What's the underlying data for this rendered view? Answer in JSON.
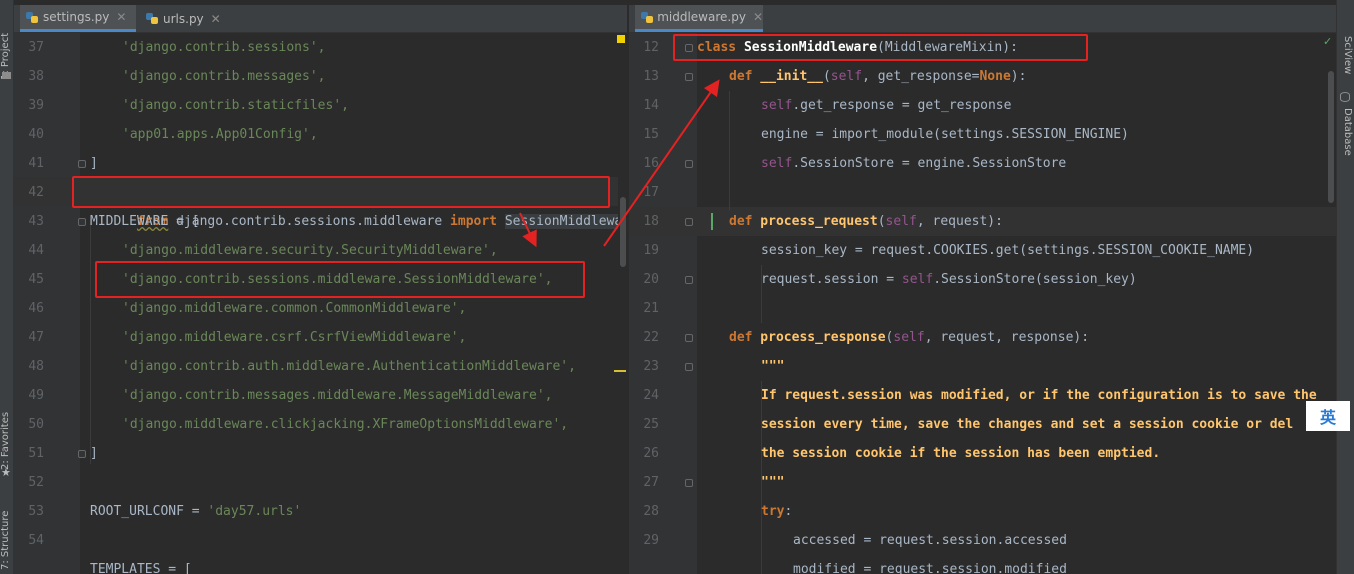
{
  "left_toolbar": {
    "project_label": "1: Project",
    "favorites_label": "2: Favorites",
    "structure_label": "7: Structure"
  },
  "right_toolbar": {
    "sciview_label": "SciView",
    "database_label": "Database"
  },
  "left_tabs": [
    {
      "label": "settings.py",
      "active": true
    },
    {
      "label": "urls.py",
      "active": false
    }
  ],
  "right_tabs": [
    {
      "label": "middleware.py",
      "active": true
    }
  ],
  "left_editor": {
    "line_numbers": [
      "37",
      "38",
      "39",
      "40",
      "41",
      "42",
      "43",
      "44",
      "45",
      "46",
      "47",
      "48",
      "49",
      "50",
      "51",
      "52",
      "53",
      "54"
    ],
    "lines": {
      "l37": "'django.contrib.sessions',",
      "l38": "'django.contrib.messages',",
      "l39": "'django.contrib.staticfiles',",
      "l40": "'app01.apps.App01Config',",
      "l41": "]",
      "l42_from": "from",
      "l42_module": " django.contrib.sessions.middleware ",
      "l42_import": "import",
      "l42_name": "SessionMiddleware",
      "l43": "MIDDLEWARE = [",
      "l44": "'django.middleware.security.SecurityMiddleware',",
      "l45": "'django.contrib.sessions.middleware.SessionMiddleware',",
      "l46": "'django.middleware.common.CommonMiddleware',",
      "l47": "'django.middleware.csrf.CsrfViewMiddleware',",
      "l48": "'django.contrib.auth.middleware.AuthenticationMiddleware',",
      "l49": "'django.contrib.messages.middleware.MessageMiddleware',",
      "l50": "'django.middleware.clickjacking.XFrameOptionsMiddleware',",
      "l51": "]",
      "l53_name": "ROOT_URLCONF = ",
      "l53_value": "'day57.urls'",
      "l55": "TEMPLATES = ["
    }
  },
  "right_editor": {
    "line_numbers": [
      "12",
      "13",
      "14",
      "15",
      "16",
      "17",
      "18",
      "19",
      "20",
      "21",
      "22",
      "23",
      "24",
      "25",
      "26",
      "27",
      "28",
      "29"
    ],
    "lines": {
      "l12_kw": "class",
      "l12_name": " SessionMiddleware",
      "l12_base": "(MiddlewareMixin):",
      "l13_kw": "def",
      "l13_name": " __init__",
      "l13_open": "(",
      "l13_self": "self",
      "l13_args": ", get_response=",
      "l13_none": "None",
      "l13_close": "):",
      "l14_self": "self",
      "l14_rest": ".get_response = get_response",
      "l15": "engine = import_module(settings.SESSION_ENGINE)",
      "l16_self": "self",
      "l16_rest": ".SessionStore = engine.SessionStore",
      "l18_kw": "def",
      "l18_name": " process_request",
      "l18_open": "(",
      "l18_self": "self",
      "l18_args": ", request):",
      "l19": "session_key = request.COOKIES.get(settings.SESSION_COOKIE_NAME)",
      "l20_a": "request.session = ",
      "l20_self": "self",
      "l20_b": ".SessionStore(session_key)",
      "l22_kw": "def",
      "l22_name": " process_response",
      "l22_open": "(",
      "l22_self": "self",
      "l22_args": ", request, response):",
      "l23": "\"\"\"",
      "l24": "If request.session was modified, or if the configuration is to save the",
      "l25": "session every time, save the changes and set a session cookie or del",
      "l26": "the session cookie if the session has been emptied.",
      "l27": "\"\"\"",
      "l28_kw": "try",
      "l28_colon": ":",
      "l29": "accessed = request.session.accessed",
      "l30": "modified = request.session.modified"
    }
  },
  "ime_indicator": "英",
  "colors": {
    "annotation_red": "#e52222",
    "string_green": "#6a8759",
    "keyword_orange": "#cc7832",
    "function_yellow": "#ffc66d",
    "self_purple": "#94558d"
  }
}
